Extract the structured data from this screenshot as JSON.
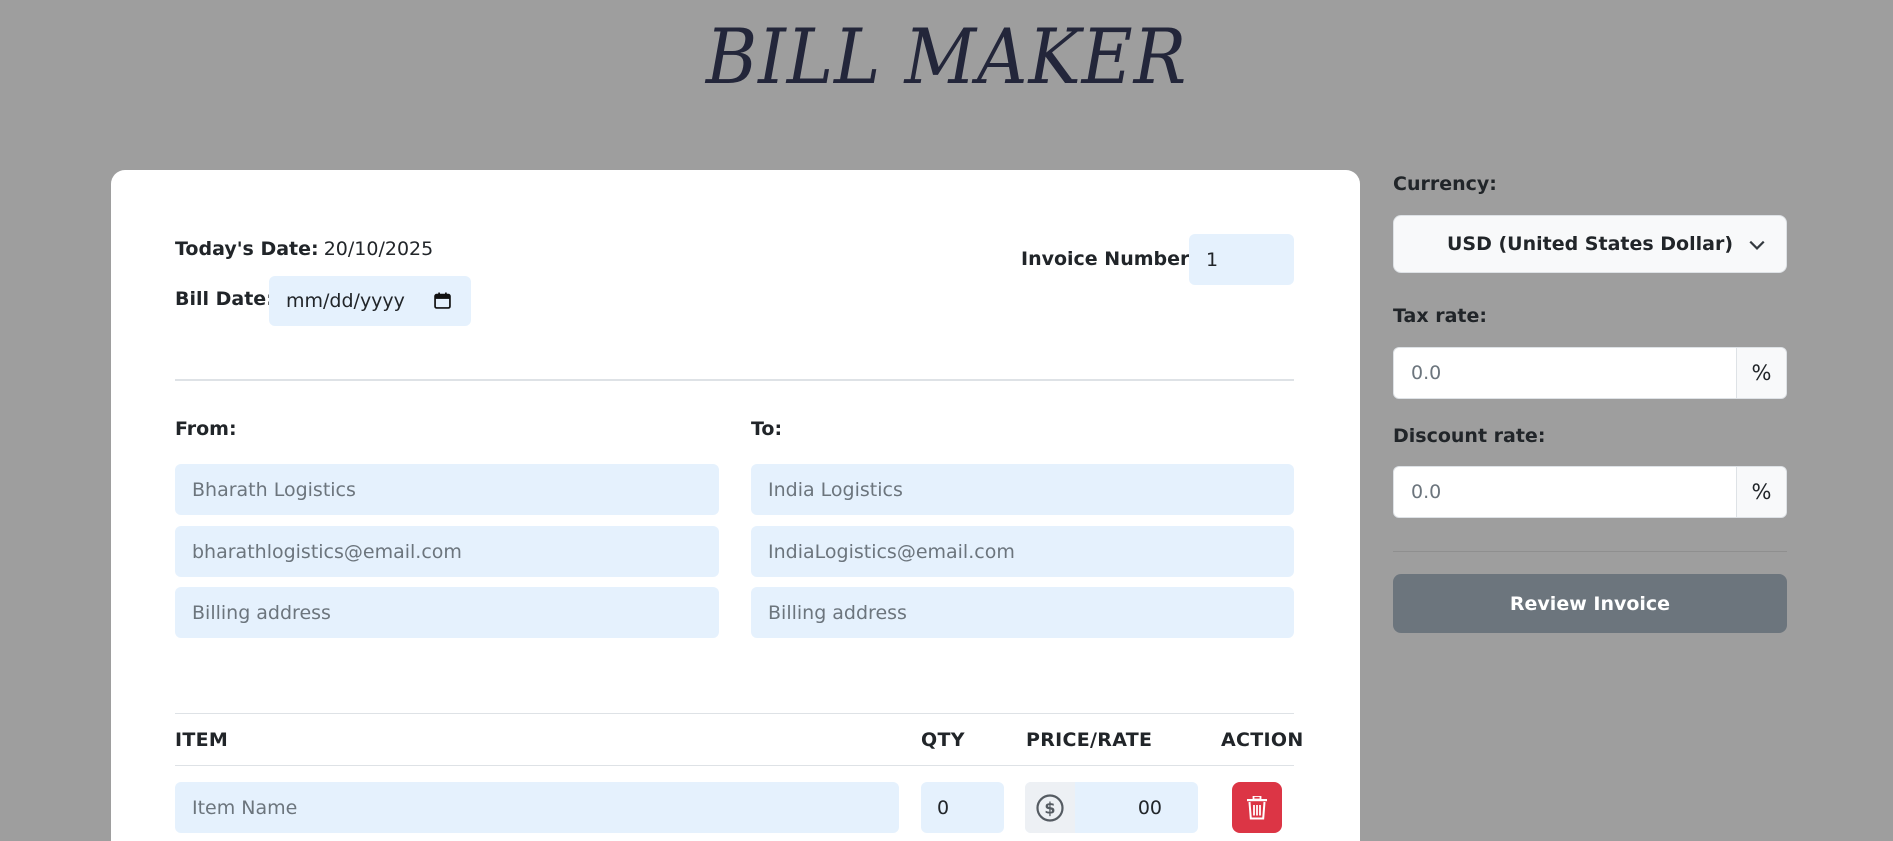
{
  "app": {
    "title": "BILL MAKER"
  },
  "invoice": {
    "todays_date_label": "Today's Date:",
    "todays_date_value": "20/10/2025",
    "bill_date_label": "Bill Date:",
    "bill_date_placeholder": "mm/dd/yyyy",
    "invoice_number_label": "Invoice Number:",
    "invoice_number_value": "1"
  },
  "from": {
    "label": "From:",
    "name_value": "Bharath Logistics",
    "email_value": "bharathlogistics@email.com",
    "address_placeholder": "Billing address"
  },
  "to": {
    "label": "To:",
    "name_value": "India Logistics",
    "email_value": "IndiaLogistics@email.com",
    "address_placeholder": "Billing address"
  },
  "items_table": {
    "columns": [
      "ITEM",
      "QTY",
      "PRICE/RATE",
      "ACTION"
    ],
    "rows": [
      {
        "item_placeholder": "Item Name",
        "qty": "0",
        "price": "00",
        "price_icon": "dollar-circle-icon",
        "action_icon": "trash-icon"
      }
    ]
  },
  "sidebar": {
    "currency_label": "Currency:",
    "currency_selected": "USD (United States Dollar)",
    "tax_label": "Tax rate:",
    "tax_placeholder": "0.0",
    "tax_addon": "%",
    "discount_label": "Discount rate:",
    "discount_placeholder": "0.0",
    "discount_addon": "%",
    "review_button_label": "Review Invoice"
  },
  "colors": {
    "page_background": "#9e9e9e",
    "input_background": "#e5f1fd",
    "review_button": "#6c757d",
    "delete_button": "#dc3545"
  }
}
